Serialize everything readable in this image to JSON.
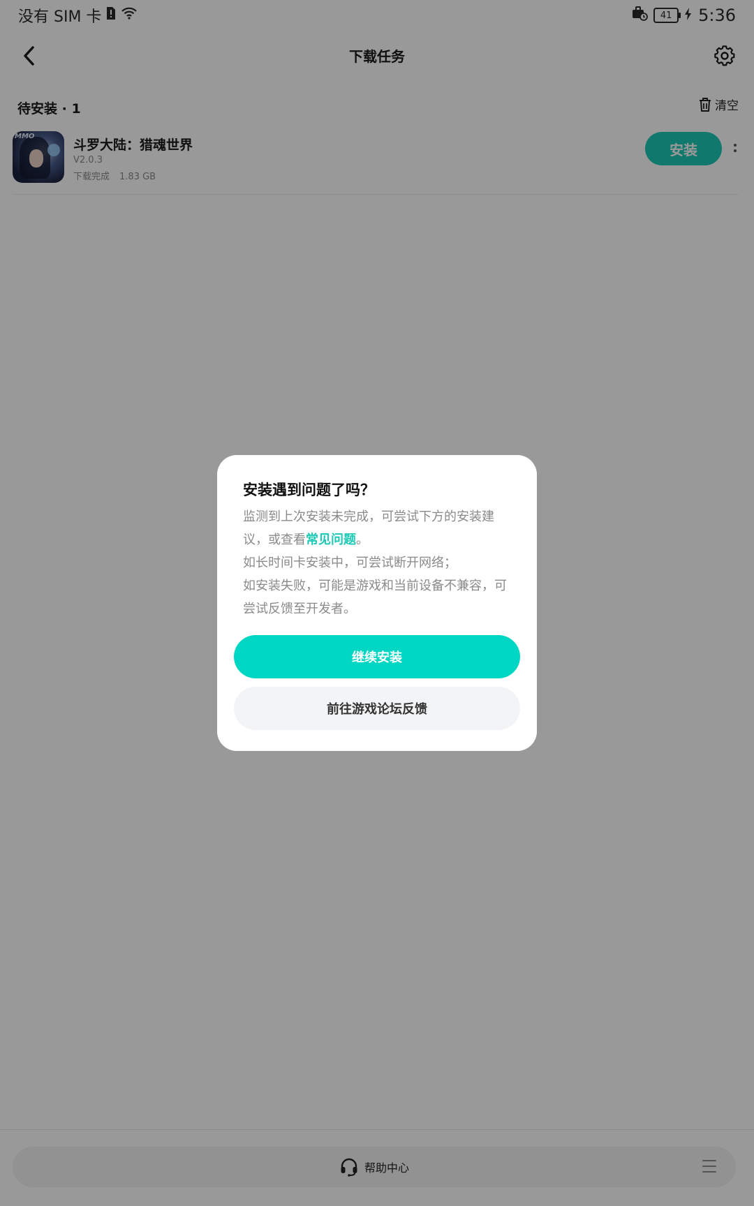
{
  "status_bar": {
    "carrier": "没有 SIM 卡",
    "battery": "41",
    "time": "5:36"
  },
  "header": {
    "title": "下载任务",
    "back_icon": "chevron-left-icon",
    "settings_icon": "gear-icon"
  },
  "section": {
    "title": "待安装 · 1",
    "clear_label": "清空"
  },
  "tasks": [
    {
      "name": "斗罗大陆：猎魂世界",
      "version": "V2.0.3",
      "status": "下载完成",
      "size": "1.83 GB",
      "icon_badge": "MMO",
      "action_label": "安装"
    }
  ],
  "footer": {
    "help_label": "帮助中心",
    "help_icon": "headset-icon",
    "menu_icon": "menu-icon"
  },
  "dialog": {
    "title": "安装遇到问题了吗？",
    "body_line1_prefix": "监测到上次安装未完成，可尝试下方的安装建议，或查看",
    "faq_link": "常见问题",
    "body_line1_suffix": "。",
    "body_line2": "如长时间卡安装中，可尝试断开网络；",
    "body_line3": "如安装失败，可能是游戏和当前设备不兼容，可尝试反馈至开发者。",
    "primary_button": "继续安装",
    "secondary_button": "前往游戏论坛反馈"
  },
  "colors": {
    "accent": "#00d6c4",
    "install_button": "#1cc9b5",
    "overlay": "rgba(0,0,0,0.4)"
  }
}
